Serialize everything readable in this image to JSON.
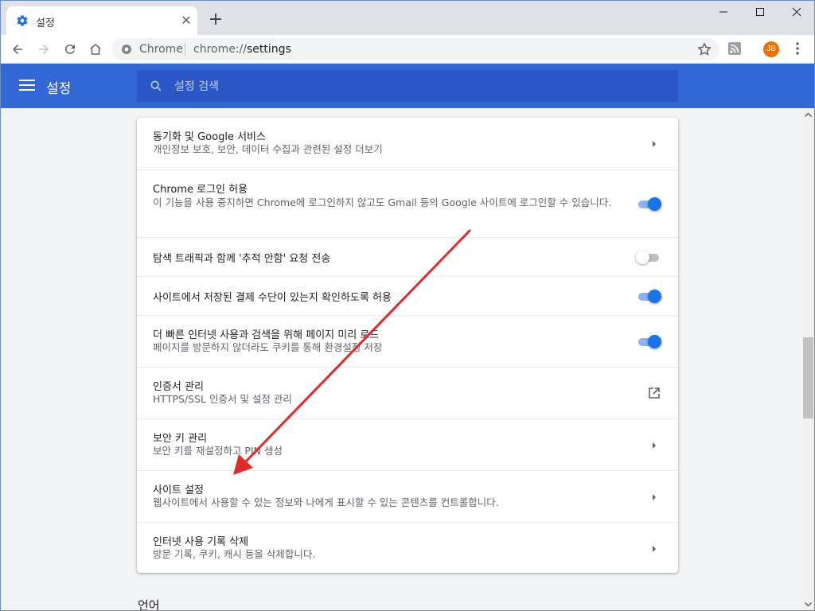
{
  "tab": {
    "title": "설정",
    "icon": "gear-icon",
    "close_icon": "close-icon"
  },
  "new_tab_icon": "plus-icon",
  "window_controls": [
    "minimize-icon",
    "maximize-icon",
    "close-icon"
  ],
  "toolbar": {
    "omnibox_site_label": "Chrome",
    "omnibox_url_scheme": "chrome://",
    "omnibox_url_path": "settings",
    "profile_initials": "JB",
    "icons": [
      "back-icon",
      "forward-icon",
      "reload-icon",
      "home-icon",
      "site-info-icon",
      "bookmark-star-icon",
      "rss-extension-icon",
      "more-menu-icon"
    ]
  },
  "settings_header": {
    "title": "설정",
    "search_placeholder": "설정 검색"
  },
  "rows": [
    {
      "title": "동기화 및 Google 서비스",
      "subtitle": "개인정보 보호, 보안, 데이터 수집과 관련된 설정 더보기",
      "control": "arrow"
    },
    {
      "title": "Chrome 로그인 허용",
      "subtitle": "이 기능을 사용 중지하면 Chrome에 로그인하지 않고도 Gmail 등의 Google 사이트에 로그인할 수 있습니다.",
      "control": "toggle",
      "on": true
    },
    {
      "title": "탐색 트래픽과 함께 '추적 안함' 요청 전송",
      "subtitle": "",
      "control": "toggle",
      "on": false
    },
    {
      "title": "사이트에서 저장된 결제 수단이 있는지 확인하도록 허용",
      "subtitle": "",
      "control": "toggle",
      "on": true
    },
    {
      "title": "더 빠른 인터넷 사용과 검색을 위해 페이지 미리 로드",
      "subtitle": "페이지를 방문하지 않더라도 쿠키를 통해 환경설정 저장",
      "control": "toggle",
      "on": true
    },
    {
      "title": "인증서 관리",
      "subtitle": "HTTPS/SSL 인증서 및 설정 관리",
      "control": "external"
    },
    {
      "title": "보안 키 관리",
      "subtitle": "보안 키를 재설정하고 PIN 생성",
      "control": "arrow"
    },
    {
      "title": "사이트 설정",
      "subtitle": "웹사이트에서 사용할 수 있는 정보와 나에게 표시할 수 있는 콘텐츠를 컨트롤합니다.",
      "control": "arrow"
    },
    {
      "title": "인터넷 사용 기록 삭제",
      "subtitle": "방문 기록, 쿠키, 캐시 등을 삭제합니다.",
      "control": "arrow"
    }
  ],
  "next_section_label": "언어",
  "colors": {
    "header_blue": "#3367d6",
    "search_bg": "#2a56c6",
    "toggle_on": "#1a73e8",
    "annotation_arrow": "#e02b2b",
    "avatar": "#e8710a"
  }
}
